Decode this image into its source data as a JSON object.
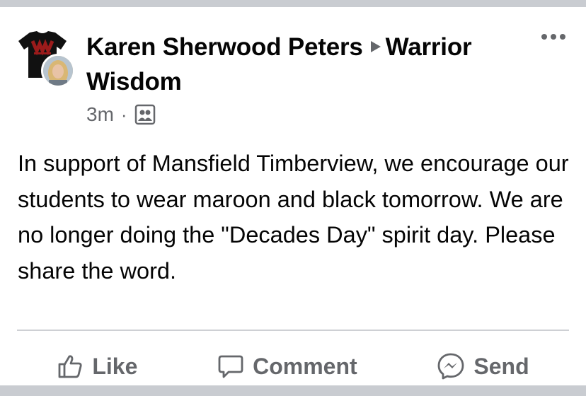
{
  "post": {
    "author": "Karen Sherwood Peters",
    "group": "Warrior Wisdom",
    "time": "3m",
    "separator": "·",
    "audience_icon": "group-members-icon",
    "body": "In support of Mansfield Timberview, we encourage our students to wear maroon and black tomorrow. We are no longer doing the \"Decades Day\" spirit day. Please share the word."
  },
  "actions": {
    "like_label": "Like",
    "comment_label": "Comment",
    "send_label": "Send"
  },
  "colors": {
    "text": "#050505",
    "secondary": "#65676b",
    "divider": "#ced0d4",
    "maroon": "#8b1a1a"
  }
}
